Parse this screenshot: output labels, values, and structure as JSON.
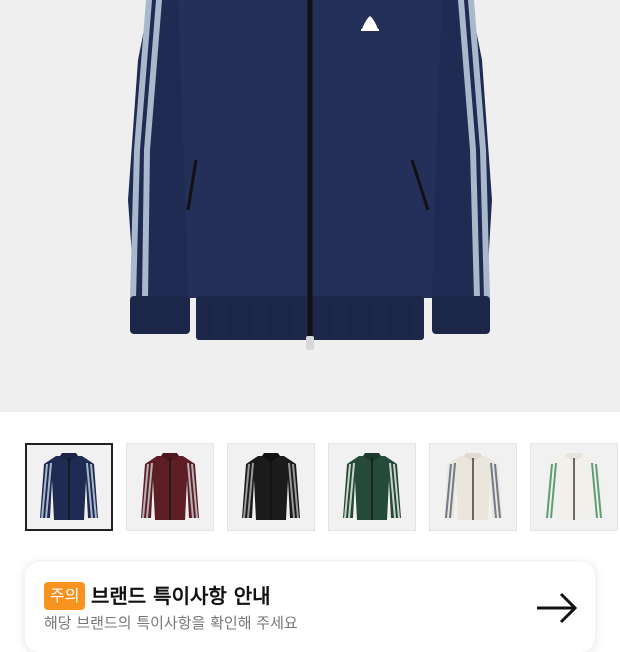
{
  "product": {
    "image_icon": "jacket-image",
    "color_options": [
      {
        "color": "navy",
        "body": "#1f2b52",
        "stripe": "#aab8cc",
        "collar": "#1a2447"
      },
      {
        "color": "burgundy",
        "body": "#5e1e26",
        "stripe": "#b7b3b7",
        "collar": "#4e161d"
      },
      {
        "color": "black",
        "body": "#1b1b1b",
        "stripe": "#9a9a9a",
        "collar": "#101010"
      },
      {
        "color": "green",
        "body": "#254a3a",
        "stripe": "#c9d4c9",
        "collar": "#1b3a2d"
      },
      {
        "color": "cream-gray",
        "body": "#ebe6dc",
        "stripe": "#6f7a8c",
        "collar": "#e0dad0"
      },
      {
        "color": "cream-green",
        "body": "#f2f0ea",
        "stripe": "#5f9c78",
        "collar": "#e8e4da"
      }
    ],
    "selected_index": 0
  },
  "notice": {
    "badge": "주의",
    "title": "브랜드 특이사항 안내",
    "subtitle": "해당 브랜드의 특이사항을 확인해 주세요",
    "arrow_icon": "arrow-right-icon"
  }
}
